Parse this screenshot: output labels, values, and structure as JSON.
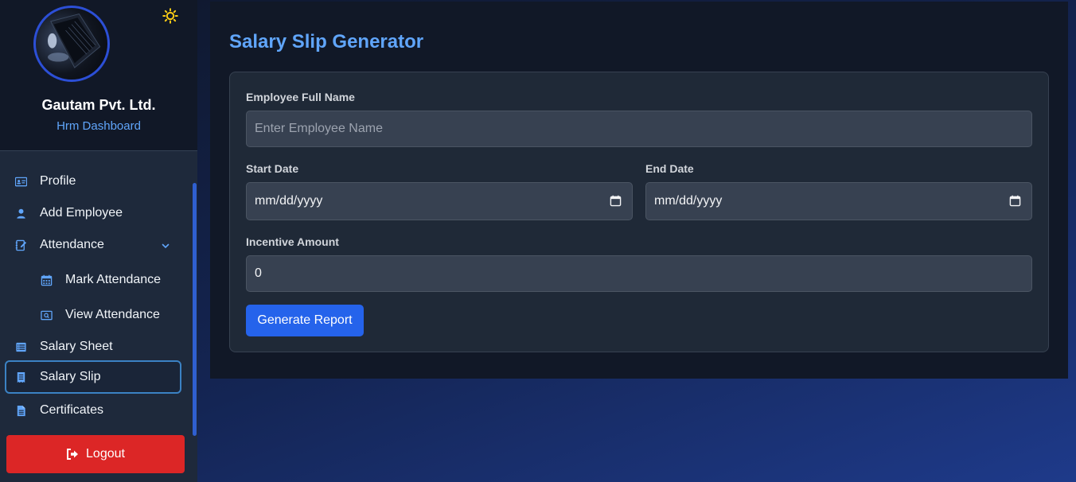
{
  "sidebar": {
    "company_name": "Gautam Pvt. Ltd.",
    "subtitle": "Hrm Dashboard",
    "theme_icon": "sun-icon",
    "items": [
      {
        "label": "Profile",
        "icon": "id-card-icon"
      },
      {
        "label": "Add Employee",
        "icon": "user-icon"
      },
      {
        "label": "Attendance",
        "icon": "notebook-pen-icon",
        "expanded": true
      },
      {
        "label": "Mark Attendance",
        "icon": "calendar-icon"
      },
      {
        "label": "View Attendance",
        "icon": "search-window-icon"
      },
      {
        "label": "Salary Sheet",
        "icon": "list-icon"
      },
      {
        "label": "Salary Slip",
        "icon": "receipt-icon",
        "active": true
      },
      {
        "label": "Certificates",
        "icon": "document-icon"
      }
    ],
    "logout_label": "Logout"
  },
  "main": {
    "title": "Salary Slip Generator",
    "form": {
      "employee_name_label": "Employee Full Name",
      "employee_name_placeholder": "Enter Employee Name",
      "employee_name_value": "",
      "start_date_label": "Start Date",
      "start_date_value": "mm/dd/yyyy",
      "end_date_label": "End Date",
      "end_date_value": "mm/dd/yyyy",
      "incentive_label": "Incentive Amount",
      "incentive_value": "0",
      "submit_label": "Generate Report"
    }
  },
  "colors": {
    "accent": "#60a5fa",
    "primary_button": "#2563eb",
    "logout": "#dc2626",
    "active_border": "#3b82c4"
  }
}
